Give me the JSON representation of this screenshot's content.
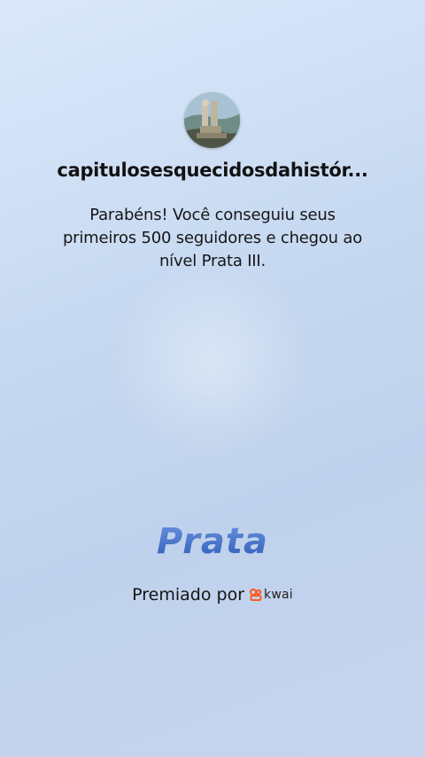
{
  "profile": {
    "username": "capitulosesquecidosdahistór..."
  },
  "message": "Parabéns! Você conseguiu seus primeiros 500 seguidores e chegou ao nível Prata III.",
  "level": {
    "title": "Prata"
  },
  "award": {
    "label": "Premiado por",
    "brand": "kwai"
  },
  "colors": {
    "level_title": "#3d6bc4",
    "brand_mark": "#ff5a1f"
  }
}
